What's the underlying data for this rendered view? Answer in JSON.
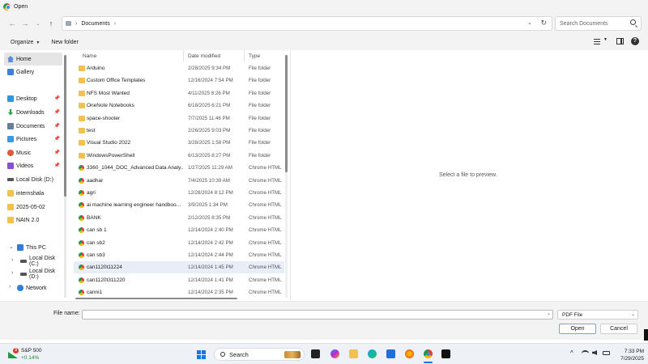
{
  "window": {
    "title": "Open"
  },
  "address": {
    "breadcrumb": [
      "Documents"
    ],
    "search_placeholder": "Search Documents"
  },
  "toolbar": {
    "organize_label": "Organize",
    "new_folder_label": "New folder"
  },
  "sidebar": {
    "quick": [
      {
        "label": "Home",
        "icon": "home-icon"
      },
      {
        "label": "Gallery",
        "icon": "gallery-icon"
      }
    ],
    "pinned": [
      {
        "label": "Desktop",
        "icon": "desktop-icon"
      },
      {
        "label": "Downloads",
        "icon": "downloads-icon"
      },
      {
        "label": "Documents",
        "icon": "documents-icon"
      },
      {
        "label": "Pictures",
        "icon": "pictures-icon"
      },
      {
        "label": "Music",
        "icon": "music-icon"
      },
      {
        "label": "Videos",
        "icon": "videos-icon"
      },
      {
        "label": "Local Disk (D:)",
        "icon": "drive-icon"
      },
      {
        "label": "internshala",
        "icon": "folder-icon"
      },
      {
        "label": "2025-05-02",
        "icon": "folder-icon"
      },
      {
        "label": "NAIN 2.0",
        "icon": "folder-icon"
      }
    ],
    "tree": [
      {
        "label": "This PC",
        "icon": "pc-icon"
      },
      {
        "label": "Local Disk (C:)",
        "icon": "drive-icon"
      },
      {
        "label": "Local Disk (D:)",
        "icon": "drive-icon"
      },
      {
        "label": "Network",
        "icon": "network-icon"
      }
    ]
  },
  "columns": {
    "name": "Name",
    "date": "Date modified",
    "type": "Type"
  },
  "files": [
    {
      "name": "Arduino",
      "date": "2/28/2025 9:34 PM",
      "type": "File folder",
      "kind": "folder"
    },
    {
      "name": "Custom Office Templates",
      "date": "12/16/2024 7:54 PM",
      "type": "File folder",
      "kind": "folder"
    },
    {
      "name": "NFS Most Wanted",
      "date": "4/11/2025 8:26 PM",
      "type": "File folder",
      "kind": "folder"
    },
    {
      "name": "OneNote Notebooks",
      "date": "6/18/2025 6:21 PM",
      "type": "File folder",
      "kind": "folder"
    },
    {
      "name": "space-shooter",
      "date": "7/7/2025 11:46 PM",
      "type": "File folder",
      "kind": "folder"
    },
    {
      "name": "test",
      "date": "2/26/2025 9:03 PM",
      "type": "File folder",
      "kind": "folder"
    },
    {
      "name": "Visual Studio 2022",
      "date": "3/28/2025 1:58 PM",
      "type": "File folder",
      "kind": "folder"
    },
    {
      "name": "WindowsPowerShell",
      "date": "6/13/2025 8:27 PM",
      "type": "File folder",
      "kind": "folder"
    },
    {
      "name": "3360_1044_DOC_Advanced Data Analy...",
      "date": "1/27/2025 11:29 AM",
      "type": "Chrome HTML",
      "kind": "html"
    },
    {
      "name": "aadhar",
      "date": "7/4/2025 10:39 AM",
      "type": "Chrome HTML",
      "kind": "html"
    },
    {
      "name": "agri",
      "date": "12/28/2024 8:12 PM",
      "type": "Chrome HTML",
      "kind": "html"
    },
    {
      "name": "ai machine learning engineer handboo...",
      "date": "3/9/2025 1:34 PM",
      "type": "Chrome HTML",
      "kind": "html"
    },
    {
      "name": "BANK",
      "date": "2/12/2025 8:35 PM",
      "type": "Chrome HTML",
      "kind": "html"
    },
    {
      "name": "can sb 1",
      "date": "12/14/2024 2:40 PM",
      "type": "Chrome HTML",
      "kind": "html"
    },
    {
      "name": "can sb2",
      "date": "12/14/2024 2:42 PM",
      "type": "Chrome HTML",
      "kind": "html"
    },
    {
      "name": "can sb3",
      "date": "12/14/2024 2:44 PM",
      "type": "Chrome HTML",
      "kind": "html"
    },
    {
      "name": "can1120t11224",
      "date": "12/14/2024 1:45 PM",
      "type": "Chrome HTML",
      "kind": "html"
    },
    {
      "name": "can1120t311220",
      "date": "12/14/2024 1:41 PM",
      "type": "Chrome HTML",
      "kind": "html"
    },
    {
      "name": "canni1",
      "date": "12/14/2024 2:35 PM",
      "type": "Chrome HTML",
      "kind": "html"
    }
  ],
  "preview": {
    "message": "Select a file to preview."
  },
  "bottom": {
    "filename_label": "File name:",
    "filename_value": "",
    "filetype_value": "PDF File",
    "open_label": "Open",
    "cancel_label": "Cancel"
  },
  "taskbar": {
    "stock_name": "S&P 500",
    "stock_change": "+0.14%",
    "notification_count": "3",
    "search_label": "Search",
    "time": "7:33 PM",
    "date": "7/29/2025"
  },
  "colors": {
    "accent": "#1a73e8",
    "folder": "#f2c14e",
    "highlight_row": "#e8eef8",
    "stock_up": "#1e8a3e"
  }
}
